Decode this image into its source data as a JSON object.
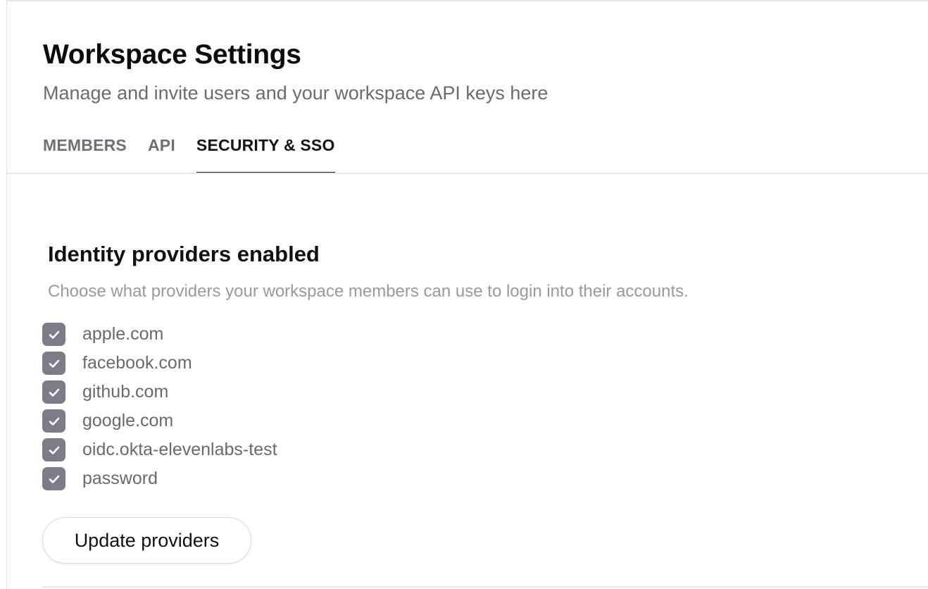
{
  "header": {
    "title": "Workspace Settings",
    "subtitle": "Manage and invite users and your workspace API keys here"
  },
  "tabs": [
    {
      "label": "MEMBERS",
      "active": false
    },
    {
      "label": "API",
      "active": false
    },
    {
      "label": "SECURITY & SSO",
      "active": true
    }
  ],
  "section": {
    "title": "Identity providers enabled",
    "description": "Choose what providers your workspace members can use to login into their accounts."
  },
  "providers": [
    {
      "label": "apple.com",
      "checked": true
    },
    {
      "label": "facebook.com",
      "checked": true
    },
    {
      "label": "github.com",
      "checked": true
    },
    {
      "label": "google.com",
      "checked": true
    },
    {
      "label": "oidc.okta-elevenlabs-test",
      "checked": true
    },
    {
      "label": "password",
      "checked": true
    }
  ],
  "actions": {
    "update_label": "Update providers"
  },
  "colors": {
    "checkbox_fill": "#7c7c88",
    "active_tab_underline": "#1a1a1a"
  },
  "icons": {
    "checkbox_mark": "check-icon"
  }
}
